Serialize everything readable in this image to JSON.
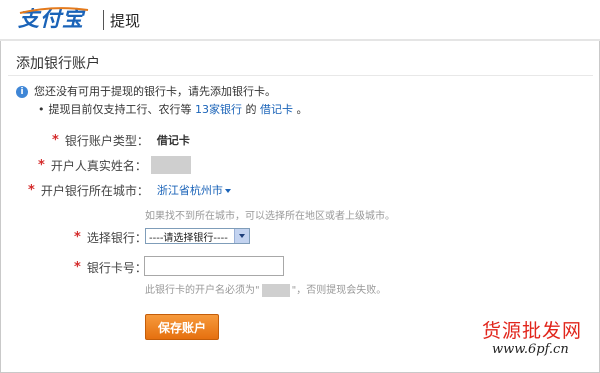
{
  "header": {
    "logo_text": "支付宝",
    "title": "提现"
  },
  "section": {
    "title": "添加银行账户"
  },
  "notice": {
    "line1": "您还没有可用于提现的银行卡，请先添加银行卡。",
    "line2_prefix": "提现目前仅支持工行、农行等",
    "banks_link": "13家银行",
    "line2_middle": "的",
    "debit_link": "借记卡",
    "line2_suffix": "。"
  },
  "form": {
    "account_type_label": "银行账户类型：",
    "account_type_value": "借记卡",
    "name_label": "开户人真实姓名：",
    "city_label": "开户银行所在城市：",
    "city_value": "浙江省杭州市",
    "city_hint": "如果找不到所在城市，可以选择所在地区或者上级城市。",
    "bank_label": "选择银行：",
    "bank_select_value": "----请选择银行----",
    "card_label": "银行卡号：",
    "card_value": "",
    "card_hint_prefix": "此银行卡的开户名必须为\"",
    "card_hint_suffix": "\"，否则提现会失败。",
    "save_button": "保存账户"
  },
  "watermark": {
    "text": "货源批发网",
    "url": "www.6pf.cn"
  },
  "colors": {
    "brand_blue": "#1a63b8",
    "required_red": "#d42b2b",
    "button_orange": "#ee8222"
  }
}
